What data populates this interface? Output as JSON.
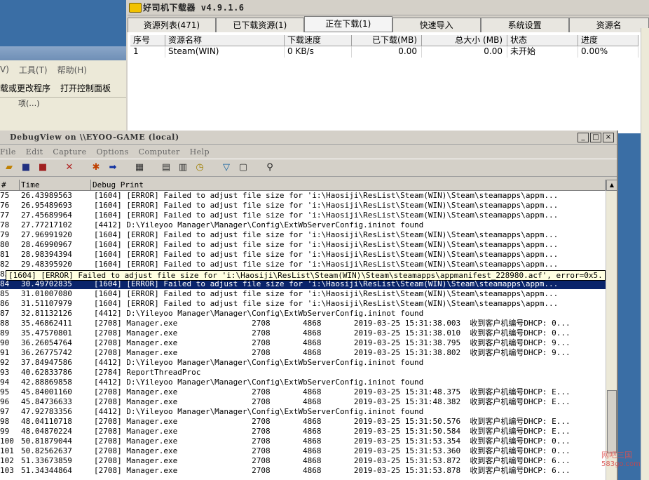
{
  "explorer": {
    "menu": [
      "V)",
      "工具(T)",
      "帮助(H)"
    ],
    "toolbar": [
      "载或更改程序",
      "打开控制面板"
    ],
    "tab_label": "项(…)"
  },
  "downloader": {
    "title": "好司机下载器 v4.9.1.6",
    "tabs": [
      "资源列表(471)",
      "已下载资源(1)",
      "正在下载(1)",
      "快速导入",
      "系统设置",
      "资源名"
    ],
    "active_tab": "正在下载(1)",
    "columns": [
      "序号",
      "资源名称",
      "下载速度",
      "已下载(MB)",
      "总大小 (MB)",
      "状态",
      "进度"
    ],
    "rows": [
      {
        "id": "1",
        "name": "Steam(WIN)",
        "speed": "0 KB/s",
        "downloaded": "0.00",
        "size": "0.00",
        "status": "未开始",
        "progress": "0.00%"
      }
    ]
  },
  "debugview": {
    "title": "DebugView on \\\\EYOO-GAME (local)",
    "menu": [
      "File",
      "Edit",
      "Capture",
      "Options",
      "Computer",
      "Help"
    ],
    "columns": [
      "#",
      "Time",
      "Debug Print"
    ],
    "selected_index": 9,
    "tooltip": "[1604] [ERROR] Failed to adjust file size for 'i:\\Haosiji\\ResList\\Steam(WIN)\\Steam\\steamapps\\appmanifest_228980.acf', error=0x5.",
    "rows": [
      {
        "n": "75",
        "t": "26.43989563",
        "p": "[1604] [ERROR] Failed to adjust file size for 'i:\\Haosiji\\ResList\\Steam(WIN)\\Steam\\steamapps\\appm..."
      },
      {
        "n": "76",
        "t": "26.95489693",
        "p": "[1604] [ERROR] Failed to adjust file size for 'i:\\Haosiji\\ResList\\Steam(WIN)\\Steam\\steamapps\\appm..."
      },
      {
        "n": "77",
        "t": "27.45689964",
        "p": "[1604] [ERROR] Failed to adjust file size for 'i:\\Haosiji\\ResList\\Steam(WIN)\\Steam\\steamapps\\appm..."
      },
      {
        "n": "78",
        "t": "27.77217102",
        "p": "[4412] D:\\Yileyoo Manager\\Manager\\Config\\ExtWbServerConfig.ininot found"
      },
      {
        "n": "79",
        "t": "27.96991920",
        "p": "[1604] [ERROR] Failed to adjust file size for 'i:\\Haosiji\\ResList\\Steam(WIN)\\Steam\\steamapps\\appm..."
      },
      {
        "n": "80",
        "t": "28.46990967",
        "p": "[1604] [ERROR] Failed to adjust file size for 'i:\\Haosiji\\ResList\\Steam(WIN)\\Steam\\steamapps\\appm..."
      },
      {
        "n": "81",
        "t": "28.98394394",
        "p": "[1604] [ERROR] Failed to adjust file size for 'i:\\Haosiji\\ResList\\Steam(WIN)\\Steam\\steamapps\\appm..."
      },
      {
        "n": "82",
        "t": "29.48395920",
        "p": "[1604] [ERROR] Failed to adjust file size for 'i:\\Haosiji\\ResList\\Steam(WIN)\\Steam\\steamapps\\appm..."
      },
      {
        "n": "83",
        "t": "",
        "p": ""
      },
      {
        "n": "84",
        "t": "30.49702835",
        "p": "[1604] [ERROR] Failed to adjust file size for 'i:\\Haosiji\\ResList\\Steam(WIN)\\Steam\\steamapps\\appm..."
      },
      {
        "n": "85",
        "t": "31.01007080",
        "p": "[1604] [ERROR] Failed to adjust file size for 'i:\\Haosiji\\ResList\\Steam(WIN)\\Steam\\steamapps\\appm..."
      },
      {
        "n": "86",
        "t": "31.51107979",
        "p": "[1604] [ERROR] Failed to adjust file size for 'i:\\Haosiji\\ResList\\Steam(WIN)\\Steam\\steamapps\\appm..."
      },
      {
        "n": "87",
        "t": "32.81132126",
        "p": "[4412] D:\\Yileyoo Manager\\Manager\\Config\\ExtWbServerConfig.ininot found"
      },
      {
        "n": "88",
        "t": "35.46862411",
        "p": "[2708] Manager.exe                2708       4868       2019-03-25 15:31:38.003  收到客户机编号DHCP: 0..."
      },
      {
        "n": "89",
        "t": "35.47570801",
        "p": "[2708] Manager.exe                2708       4868       2019-03-25 15:31:38.010  收到客户机编号DHCP: 0..."
      },
      {
        "n": "90",
        "t": "36.26054764",
        "p": "[2708] Manager.exe                2708       4868       2019-03-25 15:31:38.795  收到客户机编号DHCP: 9..."
      },
      {
        "n": "91",
        "t": "36.26775742",
        "p": "[2708] Manager.exe                2708       4868       2019-03-25 15:31:38.802  收到客户机编号DHCP: 9..."
      },
      {
        "n": "92",
        "t": "37.84947586",
        "p": "[4412] D:\\Yileyoo Manager\\Manager\\Config\\ExtWbServerConfig.ininot found"
      },
      {
        "n": "93",
        "t": "40.62833786",
        "p": "[2784] ReportThreadProc"
      },
      {
        "n": "94",
        "t": "42.88869858",
        "p": "[4412] D:\\Yileyoo Manager\\Manager\\Config\\ExtWbServerConfig.ininot found"
      },
      {
        "n": "95",
        "t": "45.84001160",
        "p": "[2708] Manager.exe                2708       4868       2019-03-25 15:31:48.375  收到客户机编号DHCP: E..."
      },
      {
        "n": "96",
        "t": "45.84736633",
        "p": "[2708] Manager.exe                2708       4868       2019-03-25 15:31:48.382  收到客户机编号DHCP: E..."
      },
      {
        "n": "97",
        "t": "47.92783356",
        "p": "[4412] D:\\Yileyoo Manager\\Manager\\Config\\ExtWbServerConfig.ininot found"
      },
      {
        "n": "98",
        "t": "48.04110718",
        "p": "[2708] Manager.exe                2708       4868       2019-03-25 15:31:50.576  收到客户机编号DHCP: E..."
      },
      {
        "n": "99",
        "t": "48.04870224",
        "p": "[2708] Manager.exe                2708       4868       2019-03-25 15:31:50.584  收到客户机编号DHCP: E..."
      },
      {
        "n": "100",
        "t": "50.81879044",
        "p": "[2708] Manager.exe                2708       4868       2019-03-25 15:31:53.354  收到客户机编号DHCP: 0..."
      },
      {
        "n": "101",
        "t": "50.82562637",
        "p": "[2708] Manager.exe                2708       4868       2019-03-25 15:31:53.360  收到客户机编号DHCP: 0..."
      },
      {
        "n": "102",
        "t": "51.33673859",
        "p": "[2708] Manager.exe                2708       4868       2019-03-25 15:31:53.872  收到客户机编号DHCP: 6..."
      },
      {
        "n": "103",
        "t": "51.34344864",
        "p": "[2708] Manager.exe                2708       4868       2019-03-25 15:31:53.878  收到客户机编号DHCP: 6..."
      }
    ]
  },
  "watermark": {
    "line1": "网吧三国",
    "line2": "583go.com"
  }
}
